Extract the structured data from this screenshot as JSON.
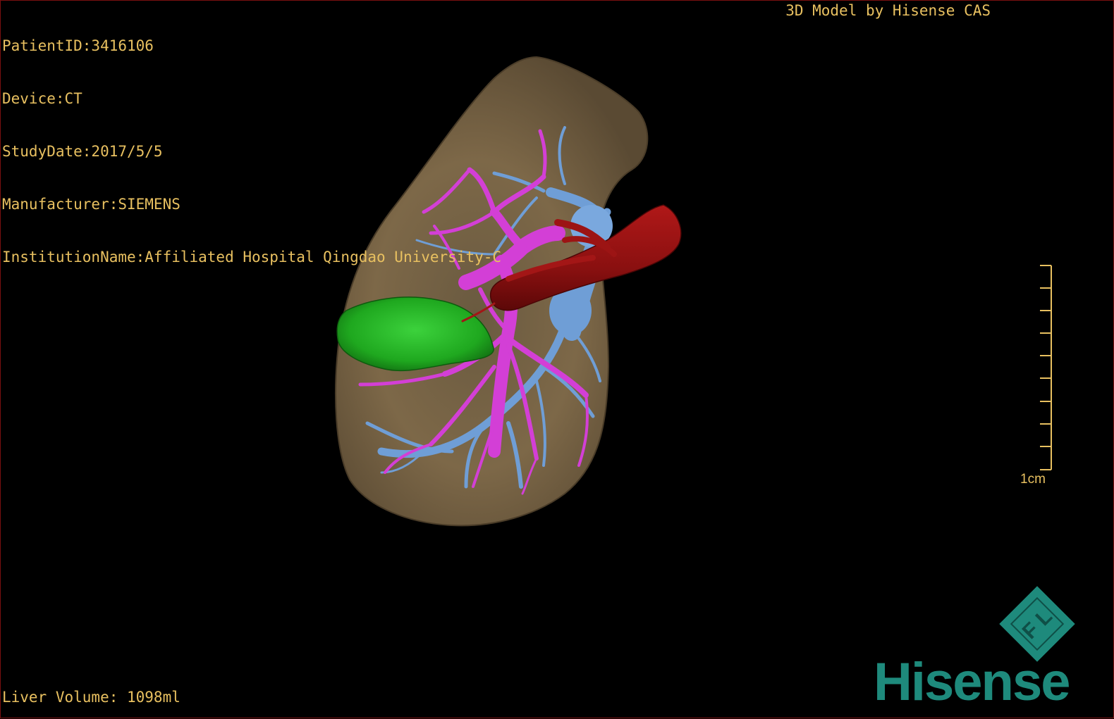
{
  "header": {
    "patient_id": "PatientID:3416106",
    "device": "Device:CT",
    "study_date": "StudyDate:2017/5/5",
    "manufacturer": "Manufacturer:SIEMENS",
    "institution": "InstitutionName:Affiliated Hospital Qingdao University-C"
  },
  "credit": "3D Model by Hisense CAS",
  "footer": {
    "liver_volume": "Liver Volume: 1098ml"
  },
  "scale_bar": {
    "label": "1cm"
  },
  "brand": {
    "name": "Hisense",
    "emblem": "F L",
    "color": "#1e8a7c"
  },
  "model": {
    "structures": [
      "liver",
      "tumor",
      "portal-vein",
      "hepatic-vein",
      "inferior-vena-cava"
    ],
    "colors": {
      "liver": "#7d6848",
      "tumor": "#1fb81f",
      "portal_vein": "#d33fd6",
      "hepatic_vein": "#6f9ed6",
      "ivc": "#8a1010",
      "text": "#e8c060"
    }
  }
}
